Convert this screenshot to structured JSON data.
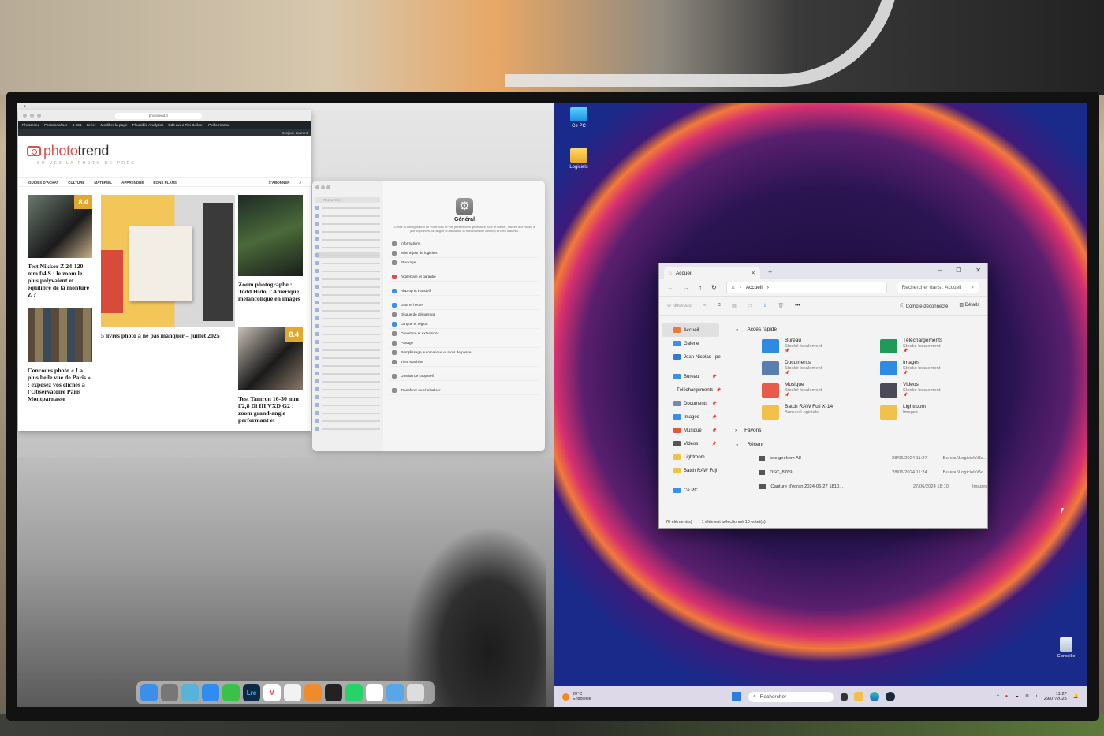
{
  "mac": {
    "browser": {
      "url": "photorend.fr",
      "wp_bar": [
        "Photorend",
        "Personnaliser",
        "4 631",
        "Créer",
        "Modifier la page",
        "Plausible Analytics",
        "Edit avec Tipi Builder",
        "Performance"
      ],
      "wp_bar2_left": "Bonjour, Laurent",
      "site": {
        "logo_accent": "photo",
        "logo_rest": "trend",
        "tagline": "SUIVEZ LA PHOTO DE PRÈS",
        "nav": [
          "GUIDES D'ACHAT",
          "CULTURE",
          "MATÉRIEL",
          "APPRENDRE",
          "BONS PLANS"
        ],
        "subscribe": "S'ABONNER"
      },
      "articles": [
        {
          "title": "Test Nikkor Z 24-120 mm f/4 S : le zoom le plus polyvalent et équilibré de la monture Z ?",
          "score": "8.4"
        },
        {
          "title": "Concours photo « La plus belle vue de Paris » : exposez vos clichés à l'Observatoire Paris Montparnasse"
        },
        {
          "title": "5 livres photo à ne pas manquer – juillet 2025"
        },
        {
          "title": "Zoom photographe : Todd Hido, l'Amérique mélancolique en images"
        },
        {
          "title": "Test Tamron 16-30 mm f/2,8 Di III VXD G2 : zoom grand-angle performant et",
          "score": "8.4"
        }
      ]
    },
    "settings": {
      "search_placeholder": "Rechercher",
      "title": "Général",
      "description": "Gérez la configuration de votre Mac et vos préférences générales pour le clavier, l'accès aux mises à jour logicielles, la langue d'utilisation, la fonctionnalité AirDrop et bien d'autres.",
      "groups": [
        [
          "Informations",
          "Mise à jour de logiciels",
          "Stockage"
        ],
        [
          "AppleCare et garantie"
        ],
        [
          "AirDrop et Handoff"
        ],
        [
          "Date et heure",
          "Disque de démarrage",
          "Langue et région",
          "Ouverture et extensions",
          "Partage",
          "Remplissage automatique et mots de passe",
          "Time Machine"
        ],
        [
          "Gestion de l'appareil"
        ],
        [
          "Transférer ou réinitialiser"
        ]
      ]
    },
    "dock": [
      {
        "icon": "finder-icon",
        "color": "#3b8fe8"
      },
      {
        "icon": "system-settings-icon",
        "color": "#777777"
      },
      {
        "icon": "app-icon",
        "color": "#58b3d9"
      },
      {
        "icon": "safari-icon",
        "color": "#2f8cf0"
      },
      {
        "icon": "messages-icon",
        "color": "#39c24a"
      },
      {
        "icon": "lightroom-icon",
        "color": "#0b2a44",
        "label": "Lrc"
      },
      {
        "icon": "gmail-icon",
        "color": "#ffffff",
        "label": "M"
      },
      {
        "icon": "notes-icon",
        "color": "#f2f2f2"
      },
      {
        "icon": "app-icon",
        "color": "#f08a2a"
      },
      {
        "icon": "app-icon",
        "color": "#222222"
      },
      {
        "icon": "whatsapp-icon",
        "color": "#25d366"
      },
      {
        "icon": "app-icon",
        "color": "#ffffff"
      },
      {
        "icon": "folder-icon",
        "color": "#58a6e8"
      },
      {
        "icon": "trash-icon",
        "color": "#dddddd"
      }
    ]
  },
  "windows": {
    "desktop_icons": [
      {
        "label": "Ce PC",
        "icon": "monitor-icon"
      },
      {
        "label": "Logiciels",
        "icon": "folder-icon"
      }
    ],
    "explorer": {
      "tab_title": "Accueil",
      "breadcrumb": "Accueil",
      "search_placeholder": "Rechercher dans : Accueil",
      "cmd_new": "Nouveau",
      "cmd_account": "Compte déconnecté",
      "cmd_details": "Détails",
      "nav": [
        {
          "label": "Accueil",
          "color": "#e87a3a",
          "selected": true
        },
        {
          "label": "Galerie",
          "color": "#3b8fe8"
        },
        {
          "label": "Jean-Nicolas - pe",
          "color": "#2f7ad9"
        },
        {
          "label": "Bureau",
          "color": "#3b8fe8",
          "pin": true
        },
        {
          "label": "Téléchargements",
          "color": "#2aa56a",
          "pin": true
        },
        {
          "label": "Documents",
          "color": "#6b8db5",
          "pin": true
        },
        {
          "label": "Images",
          "color": "#3b8fe8",
          "pin": true
        },
        {
          "label": "Musique",
          "color": "#e8553a",
          "pin": true
        },
        {
          "label": "Vidéos",
          "color": "#555555",
          "pin": true
        },
        {
          "label": "Lightroom",
          "color": "#f2c14a"
        },
        {
          "label": "Batch RAW Fuji",
          "color": "#f2c14a"
        },
        {
          "label": "Ce PC",
          "color": "#3b8fe8"
        }
      ],
      "quick_access_label": "Accès rapide",
      "favorites_label": "Favoris",
      "recent_label": "Récent",
      "tiles": [
        {
          "name": "Bureau",
          "sub": "Stocké localement",
          "color": "#2d8be3"
        },
        {
          "name": "Téléchargements",
          "sub": "Stocké localement",
          "color": "#1f9a5a"
        },
        {
          "name": "Documents",
          "sub": "Stocké localement",
          "color": "#5a7fae"
        },
        {
          "name": "Images",
          "sub": "Stocké localement",
          "color": "#2d8be3"
        },
        {
          "name": "Musique",
          "sub": "Stocké localement",
          "color": "#e85a4a"
        },
        {
          "name": "Vidéos",
          "sub": "Stocké localement",
          "color": "#4a4a58"
        },
        {
          "name": "Batch RAW Fuji X-14",
          "sub": "Bureau\\Logiciels",
          "color": "#f2c14a"
        },
        {
          "name": "Lightroom",
          "sub": "Images",
          "color": "#f2c14a"
        }
      ],
      "recent": [
        {
          "name": "tets geekom A8",
          "date": "28/06/2024 11:27",
          "path": "Bureau\\Logiciels\\Ba..."
        },
        {
          "name": "DSC_8769",
          "date": "28/06/2024 11:24",
          "path": "Bureau\\Logiciels\\Ba..."
        },
        {
          "name": "Capture d'écran 2024-06-27 1810...",
          "date": "27/06/2024 18:10",
          "path": "Images"
        }
      ],
      "status_count": "70 élément(s)",
      "status_selected": "1 élément sélectionné 10 octet(s)"
    },
    "taskbar": {
      "temp": "20°C",
      "weather": "Ensoleillé",
      "search": "Rechercher",
      "time": "11:27",
      "date": "29/07/2025"
    },
    "recycle_bin": "Corbeille"
  }
}
